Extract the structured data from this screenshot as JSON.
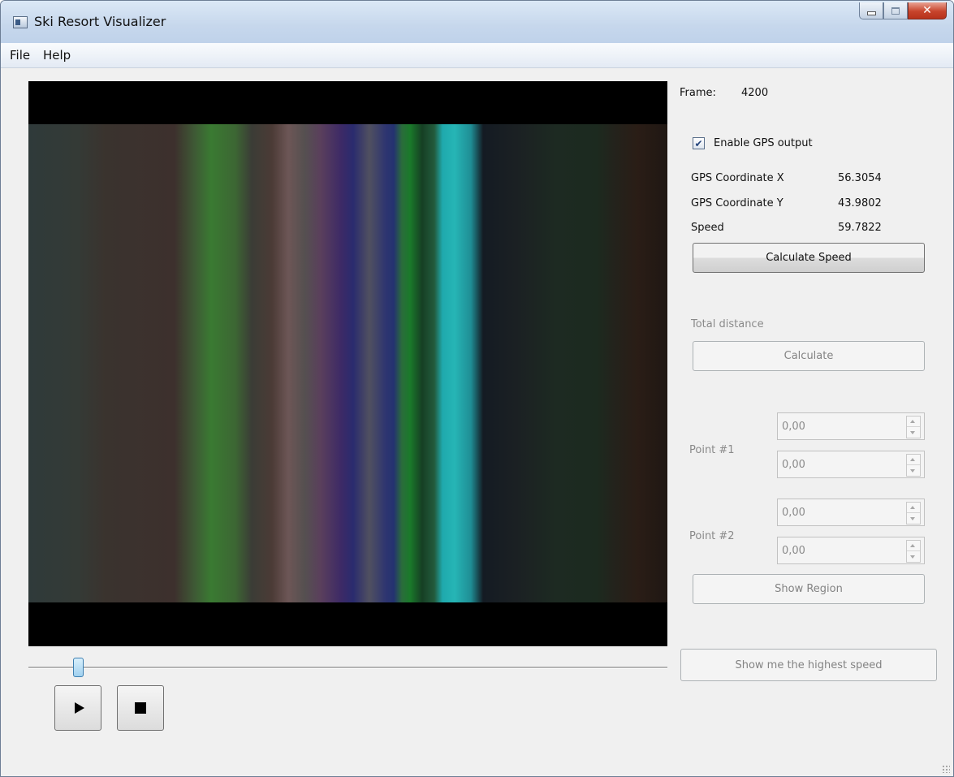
{
  "window": {
    "title": "Ski Resort Visualizer"
  },
  "menu": {
    "file": "File",
    "help": "Help"
  },
  "video": {
    "position_fraction": 0.08
  },
  "transport": {
    "play_icon": "play-icon",
    "stop_icon": "stop-icon"
  },
  "panel": {
    "frame_label": "Frame:",
    "frame_value": "4200",
    "gps_checkbox_label": "Enable GPS output",
    "gps_checked": true,
    "gps_x_label": "GPS Coordinate X",
    "gps_x_value": "56.3054",
    "gps_y_label": "GPS Coordinate Y",
    "gps_y_value": "43.9802",
    "speed_label": "Speed",
    "speed_value": "59.7822",
    "calc_speed_button": "Calculate Speed",
    "total_distance_label": "Total distance",
    "calculate_button": "Calculate",
    "point1_label": "Point #1",
    "point1_a": "0,00",
    "point1_b": "0,00",
    "point2_label": "Point #2",
    "point2_a": "0,00",
    "point2_b": "0,00",
    "show_region_button": "Show Region",
    "highest_speed_button": "Show me the highest speed"
  }
}
